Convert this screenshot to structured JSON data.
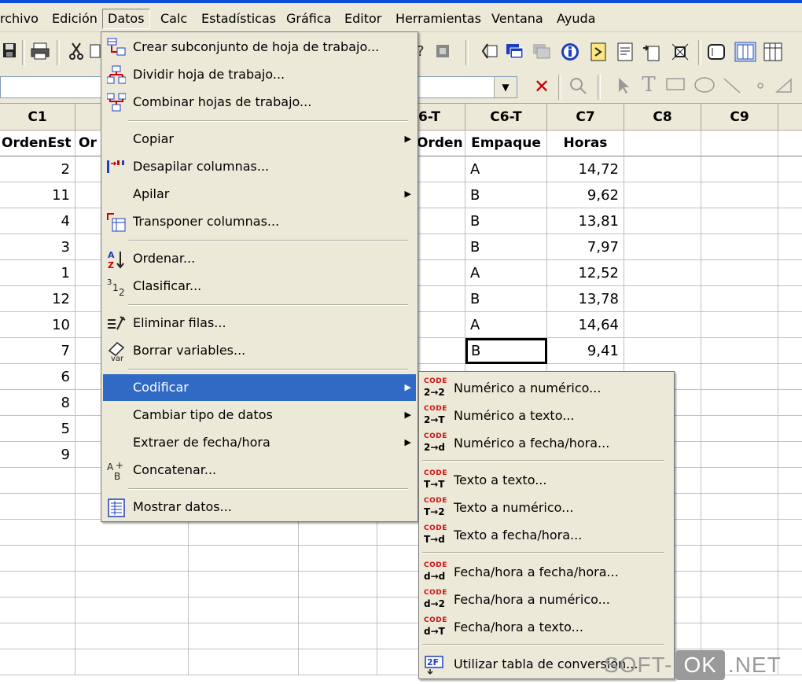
{
  "menubar": {
    "items": [
      "rchivo",
      "Edición",
      "Datos",
      "Calc",
      "Estadísticas",
      "Gráfica",
      "Editor",
      "Herramientas",
      "Ventana",
      "Ayuda"
    ],
    "active": "Datos"
  },
  "columns": {
    "headers": [
      "C1",
      "C6-T",
      "C7",
      "C8",
      "C9"
    ],
    "partial_header": "6-T",
    "names": [
      "OrdenEst",
      "Or",
      "Orden",
      "Empaque",
      "Horas"
    ]
  },
  "rows": {
    "c1": [
      "2",
      "11",
      "4",
      "3",
      "1",
      "12",
      "10",
      "7",
      "6",
      "8",
      "5",
      "9"
    ],
    "c6": [
      "A",
      "B",
      "B",
      "B",
      "A",
      "B",
      "A",
      "B"
    ],
    "c7": [
      "14,72",
      "9,62",
      "13,81",
      "7,97",
      "12,52",
      "13,78",
      "14,64",
      "9,41"
    ]
  },
  "datos_menu": {
    "items": [
      {
        "label": "Crear subconjunto de hoja de trabajo...",
        "icon": "subset-worksheet-icon"
      },
      {
        "label": "Dividir hoja de trabajo...",
        "icon": "split-worksheet-icon"
      },
      {
        "label": "Combinar hojas de trabajo...",
        "icon": "merge-worksheets-icon"
      },
      {
        "label": "Copiar",
        "submenu": true
      },
      {
        "label": "Desapilar columnas...",
        "icon": "unstack-columns-icon"
      },
      {
        "label": "Apilar",
        "submenu": true
      },
      {
        "label": "Transponer columnas...",
        "icon": "transpose-columns-icon"
      },
      {
        "label": "Ordenar...",
        "icon": "sort-az-icon"
      },
      {
        "label": "Clasificar...",
        "icon": "rank-icon"
      },
      {
        "label": "Eliminar filas...",
        "icon": "delete-rows-icon"
      },
      {
        "label": "Borrar variables...",
        "icon": "erase-variables-icon"
      },
      {
        "label": "Codificar",
        "submenu": true,
        "highlighted": true
      },
      {
        "label": "Cambiar tipo de datos",
        "submenu": true
      },
      {
        "label": "Extraer de fecha/hora",
        "submenu": true
      },
      {
        "label": "Concatenar...",
        "icon": "concatenate-icon"
      },
      {
        "label": "Mostrar datos...",
        "icon": "display-data-icon"
      }
    ]
  },
  "codificar_menu": {
    "code_tag": "CODE",
    "items": [
      {
        "label": "Numérico a numérico...",
        "code": "2→2"
      },
      {
        "label": "Numérico a texto...",
        "code": "2→T"
      },
      {
        "label": "Numérico a fecha/hora...",
        "code": "2→d"
      },
      {
        "label": "Texto a texto...",
        "code": "T→T"
      },
      {
        "label": "Texto a numérico...",
        "code": "T→2"
      },
      {
        "label": "Texto a fecha/hora...",
        "code": "T→d"
      },
      {
        "label": "Fecha/hora a fecha/hora...",
        "code": "d→d"
      },
      {
        "label": "Fecha/hora a numérico...",
        "code": "d→2"
      },
      {
        "label": "Fecha/hora a texto...",
        "code": "d→T"
      },
      {
        "label": "Utilizar tabla de conversión..."
      }
    ]
  },
  "watermark": {
    "left": "SOFT-",
    "box": "OK",
    ".net": ".NET"
  }
}
